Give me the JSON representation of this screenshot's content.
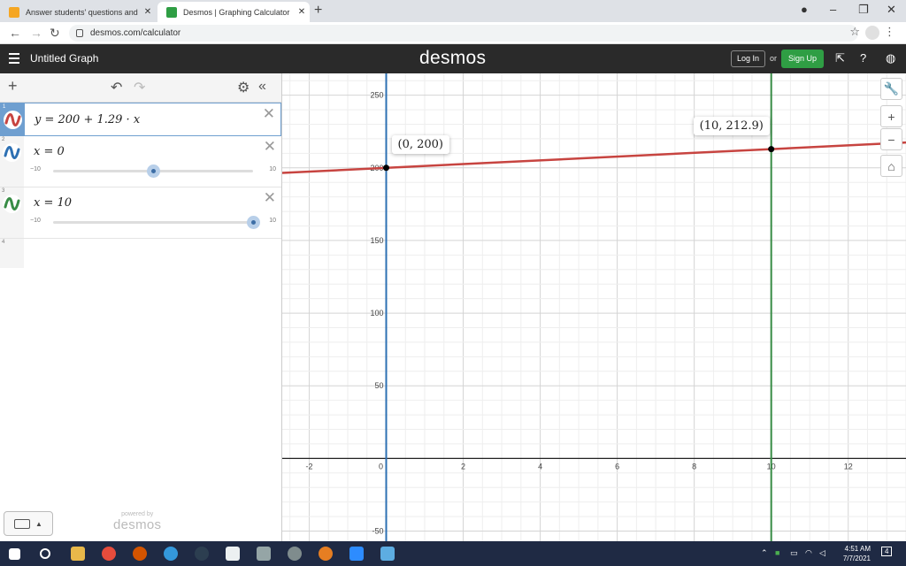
{
  "browser": {
    "tabs": [
      {
        "title": "Answer students' questions and",
        "active": false
      },
      {
        "title": "Desmos | Graphing Calculator",
        "active": true
      }
    ],
    "url": "desmos.com/calculator"
  },
  "header": {
    "graph_title": "Untitled Graph",
    "brand": "desmos",
    "login_label": "Log In",
    "or_label": "or",
    "signup_label": "Sign Up",
    "colors": {
      "bar": "#2a2a2a",
      "signup": "#2f9e44"
    }
  },
  "expressions": [
    {
      "num": "1",
      "latex": "y = 200 + 1.29 · x",
      "color": "#c74440",
      "selected": true
    },
    {
      "num": "2",
      "latex": "x = 0",
      "color": "#2d70b3",
      "slider": {
        "min": "−10",
        "max": "10",
        "value": 0
      }
    },
    {
      "num": "3",
      "latex": "x = 10",
      "color": "#388c46",
      "slider": {
        "min": "−10",
        "max": "10",
        "value": 10
      }
    }
  ],
  "empty_row_num": "4",
  "powered_by": {
    "line1": "powered by",
    "line2": "desmos"
  },
  "graph": {
    "x_ticks": [
      "-2",
      "0",
      "2",
      "4",
      "6",
      "8",
      "10",
      "12"
    ],
    "y_ticks": [
      "250",
      "200",
      "150",
      "100",
      "50",
      "-50"
    ],
    "x_range": [
      -2.7,
      13.5
    ],
    "y_range": [
      -57,
      265
    ],
    "line": {
      "intercept": 200,
      "slope": 1.29,
      "color": "#c74440"
    },
    "vlines": [
      {
        "x": 0,
        "color": "#2d70b3"
      },
      {
        "x": 10,
        "color": "#388c46"
      }
    ],
    "points": [
      {
        "x": 0,
        "y": 200,
        "label": "(0, 200)"
      },
      {
        "x": 10,
        "y": 212.9,
        "label": "(10, 212.9)"
      }
    ]
  },
  "taskbar": {
    "time": "4:51 AM",
    "date": "7/7/2021",
    "notifications": "4"
  }
}
